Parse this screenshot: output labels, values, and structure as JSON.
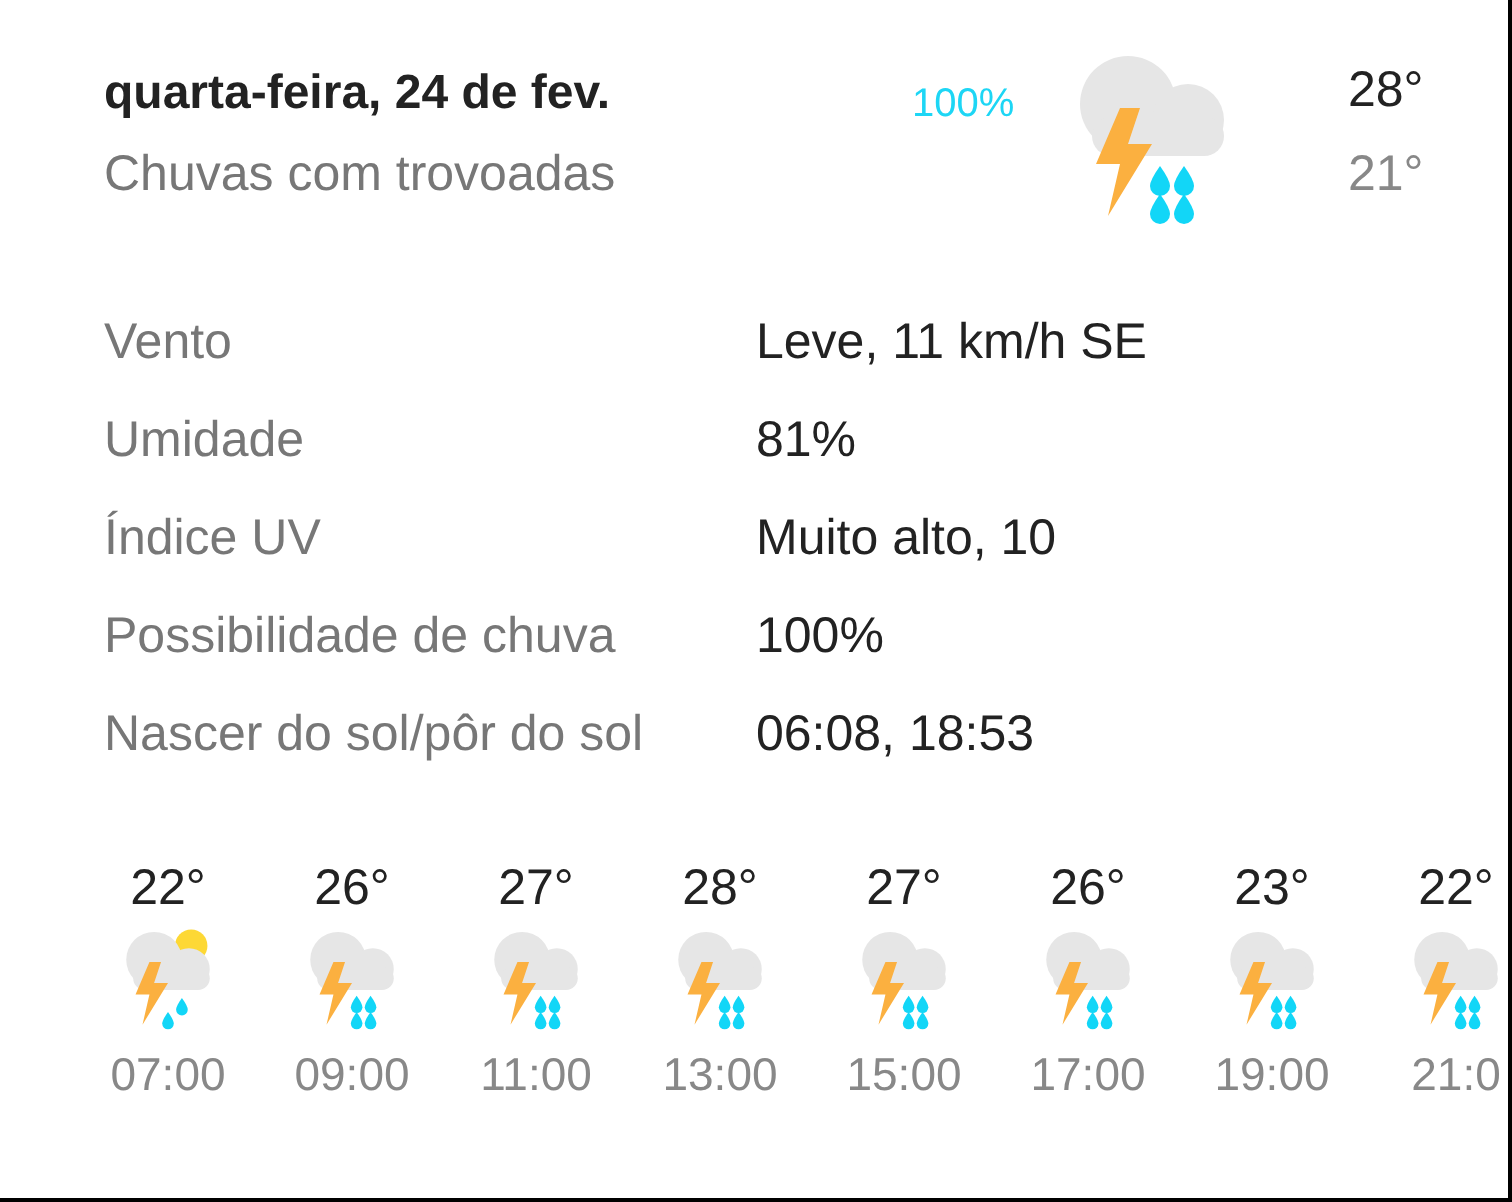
{
  "day": {
    "date": "quarta-feira, 24 de fev.",
    "condition": "Chuvas com trovoadas",
    "precip": "100%",
    "kind": "storm",
    "high": "28°",
    "low": "21°"
  },
  "details": [
    {
      "label": "Vento",
      "value": "Leve, 11 km/h SE"
    },
    {
      "label": "Umidade",
      "value": "81%"
    },
    {
      "label": "Índice UV",
      "value": "Muito alto, 10"
    },
    {
      "label": "Possibilidade de chuva",
      "value": "100%"
    },
    {
      "label": "Nascer do sol/pôr do sol",
      "value": "06:08, 18:53"
    }
  ],
  "hourly": [
    {
      "temp": "22°",
      "kind": "partly",
      "time": "07:00"
    },
    {
      "temp": "26°",
      "kind": "storm",
      "time": "09:00"
    },
    {
      "temp": "27°",
      "kind": "storm",
      "time": "11:00"
    },
    {
      "temp": "28°",
      "kind": "storm",
      "time": "13:00"
    },
    {
      "temp": "27°",
      "kind": "storm",
      "time": "15:00"
    },
    {
      "temp": "26°",
      "kind": "storm",
      "time": "17:00"
    },
    {
      "temp": "23°",
      "kind": "storm",
      "time": "19:00"
    },
    {
      "temp": "22°",
      "kind": "storm",
      "time": "21:0"
    }
  ]
}
